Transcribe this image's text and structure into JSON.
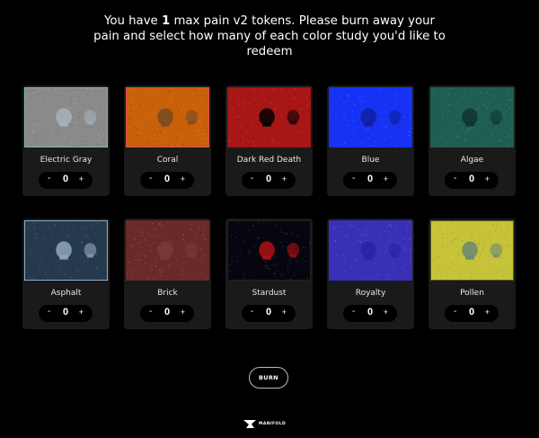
{
  "headline": {
    "prefix": "You have ",
    "count": "1",
    "suffix": " max pain v2 tokens. Please burn away your pain and select how many of each color study you'd like to redeem"
  },
  "studies": [
    {
      "name": "Electric Gray",
      "quantity": "0",
      "minus": "-",
      "plus": "+",
      "tint": "#8a8a8a",
      "border": "#7ab7b7",
      "skull": "#a5b3ba"
    },
    {
      "name": "Coral",
      "quantity": "0",
      "minus": "-",
      "plus": "+",
      "tint": "#c9600a",
      "border": "#e05050",
      "skull": "#7a4a20"
    },
    {
      "name": "Dark Red Death",
      "quantity": "0",
      "minus": "-",
      "plus": "+",
      "tint": "#a81616",
      "border": "#9c1414",
      "skull": "#050000"
    },
    {
      "name": "Blue",
      "quantity": "0",
      "minus": "-",
      "plus": "+",
      "tint": "#1632f5",
      "border": "#1632f5",
      "skull": "#1020a0"
    },
    {
      "name": "Algae",
      "quantity": "0",
      "minus": "-",
      "plus": "+",
      "tint": "#1f5f52",
      "border": "#1f5f52",
      "skull": "#0f3530"
    },
    {
      "name": "Asphalt",
      "quantity": "0",
      "minus": "-",
      "plus": "+",
      "tint": "#263a4d",
      "border": "#8fb0c8",
      "skull": "#8fa8b8"
    },
    {
      "name": "Brick",
      "quantity": "0",
      "minus": "-",
      "plus": "+",
      "tint": "#6a2b28",
      "border": "#6a2b28",
      "skull": "#7a3a36"
    },
    {
      "name": "Stardust",
      "quantity": "0",
      "minus": "-",
      "plus": "+",
      "tint": "#05060f",
      "border": "#222",
      "skull": "#b01010"
    },
    {
      "name": "Royalty",
      "quantity": "0",
      "minus": "-",
      "plus": "+",
      "tint": "#3a30b8",
      "border": "#3a30b8",
      "skull": "#2a22a0"
    },
    {
      "name": "Pollen",
      "quantity": "0",
      "minus": "-",
      "plus": "+",
      "tint": "#c6c33a",
      "border": "#5a5a20",
      "skull": "#6a8a70"
    }
  ],
  "burn_label": "BURN",
  "footer": {
    "brand": "MANIFOLD",
    "icon": "manifold-logo-icon"
  }
}
